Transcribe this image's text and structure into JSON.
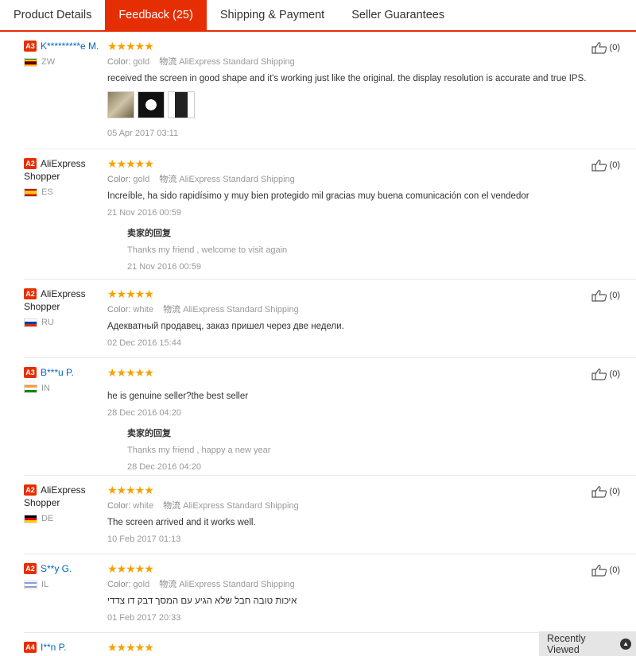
{
  "tabs": [
    {
      "label": "Product Details"
    },
    {
      "label": "Feedback (25)"
    },
    {
      "label": "Shipping & Payment"
    },
    {
      "label": "Seller Guarantees"
    }
  ],
  "reviews": [
    {
      "level": "A3",
      "name": "K*********e M.",
      "country": "ZW",
      "stars": "★★★★★",
      "color_label": "Color:",
      "color": "gold",
      "ship_label": "物流",
      "shipping": "AliExpress Standard Shipping",
      "text": "received the screen in good shape and it's working just like the original. the display resolution is accurate and true IPS.",
      "date": "05 Apr 2017 03:11",
      "helpful": "(0)"
    },
    {
      "level": "A2",
      "name": "AliExpress Shopper",
      "country": "ES",
      "stars": "★★★★★",
      "color_label": "Color:",
      "color": "gold",
      "ship_label": "物流",
      "shipping": "AliExpress Standard Shipping",
      "text": "Increíble, ha sido rapidísimo y muy bien protegido mil gracias muy buena comunicación con el vendedor",
      "date": "21 Nov 2016 00:59",
      "helpful": "(0)",
      "reply": {
        "title": "卖家的回复",
        "text": "Thanks my friend , welcome to visit again",
        "date": "21 Nov 2016 00:59"
      }
    },
    {
      "level": "A2",
      "name": "AliExpress Shopper",
      "country": "RU",
      "stars": "★★★★★",
      "color_label": "Color:",
      "color": "white",
      "ship_label": "物流",
      "shipping": "AliExpress Standard Shipping",
      "text": "Адекватный продавец, заказ пришел через две недели.",
      "date": "02 Dec 2016 15:44",
      "helpful": "(0)"
    },
    {
      "level": "A3",
      "name": "B***u P.",
      "country": "IN",
      "stars": "★★★★★",
      "text": "he is genuine seller?the best seller",
      "date": "28 Dec 2016 04:20",
      "helpful": "(0)",
      "reply": {
        "title": "卖家的回复",
        "text": "Thanks my friend , happy a new year",
        "date": "28 Dec 2016 04:20"
      }
    },
    {
      "level": "A2",
      "name": "AliExpress Shopper",
      "country": "DE",
      "stars": "★★★★★",
      "color_label": "Color:",
      "color": "white",
      "ship_label": "物流",
      "shipping": "AliExpress Standard Shipping",
      "text": "The screen arrived and it works well.",
      "date": "10 Feb 2017 01:13",
      "helpful": "(0)"
    },
    {
      "level": "A2",
      "name": "S**y G.",
      "country": "IL",
      "stars": "★★★★★",
      "color_label": "Color:",
      "color": "gold",
      "ship_label": "物流",
      "shipping": "AliExpress Standard Shipping",
      "text": "איכות טובה חבל שלא הגיע עם המסך דבק דו צדדי",
      "date": "01 Feb 2017 20:33",
      "helpful": "(0)"
    },
    {
      "level": "A4",
      "name": "I**n P.",
      "stars": "★★★★★"
    }
  ],
  "recently_viewed": "Recently Viewed",
  "colors": {
    "accent": "#e62e04",
    "star": "#f7a100",
    "link": "#0066c0"
  }
}
